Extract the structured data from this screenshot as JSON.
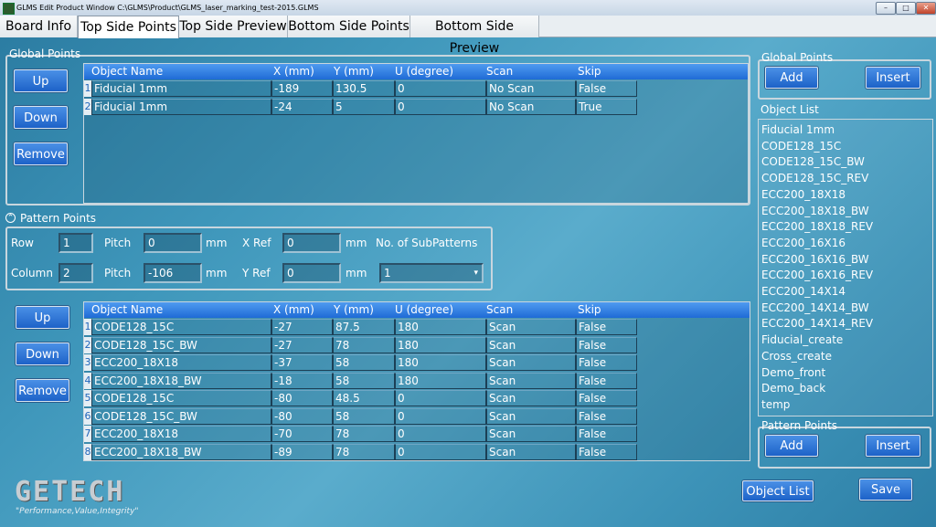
{
  "window": {
    "title": "GLMS Edit Product Window C:\\GLMS\\Product\\GLMS_laser_marking_test-2015.GLMS",
    "min": "–",
    "max": "□",
    "close": "✕"
  },
  "tabs": [
    "Board Info",
    "Top Side Points",
    "Top Side Preview",
    "Bottom Side Points",
    "Bottom Side Preview"
  ],
  "global_points": {
    "label": "Global Points",
    "up": "Up",
    "down": "Down",
    "remove": "Remove",
    "columns": [
      "Object Name",
      "X (mm)",
      "Y (mm)",
      "U (degree)",
      "Scan",
      "Skip"
    ],
    "rows": [
      {
        "n": "1",
        "name": "Fiducial 1mm",
        "x": "-189",
        "y": "130.5",
        "u": "0",
        "scan": "No Scan",
        "skip": "False"
      },
      {
        "n": "2",
        "name": "Fiducial 1mm",
        "x": "-24",
        "y": "5",
        "u": "0",
        "scan": "No Scan",
        "skip": "True"
      }
    ]
  },
  "pattern_points": {
    "label": "Pattern Points",
    "row_label": "Row",
    "row_value": "1",
    "column_label": "Column",
    "column_value": "2",
    "pitch_label": "Pitch",
    "pitch_row": "0",
    "pitch_col": "-106",
    "mm": "mm",
    "xref_label": "X Ref",
    "xref_value": "0",
    "yref_label": "Y Ref",
    "yref_value": "0",
    "subpatterns_label": "No. of SubPatterns",
    "subpatterns_value": "1",
    "up": "Up",
    "down": "Down",
    "remove": "Remove",
    "columns": [
      "Object Name",
      "X (mm)",
      "Y (mm)",
      "U (degree)",
      "Scan",
      "Skip"
    ],
    "rows": [
      {
        "n": "1",
        "name": "CODE128_15C",
        "x": "-27",
        "y": "87.5",
        "u": "180",
        "scan": "Scan",
        "skip": "False"
      },
      {
        "n": "2",
        "name": "CODE128_15C_BW",
        "x": "-27",
        "y": "78",
        "u": "180",
        "scan": "Scan",
        "skip": "False"
      },
      {
        "n": "3",
        "name": "ECC200_18X18",
        "x": "-37",
        "y": "58",
        "u": "180",
        "scan": "Scan",
        "skip": "False"
      },
      {
        "n": "4",
        "name": "ECC200_18X18_BW",
        "x": "-18",
        "y": "58",
        "u": "180",
        "scan": "Scan",
        "skip": "False"
      },
      {
        "n": "5",
        "name": "CODE128_15C",
        "x": "-80",
        "y": "48.5",
        "u": "0",
        "scan": "Scan",
        "skip": "False"
      },
      {
        "n": "6",
        "name": "CODE128_15C_BW",
        "x": "-80",
        "y": "58",
        "u": "0",
        "scan": "Scan",
        "skip": "False"
      },
      {
        "n": "7",
        "name": "ECC200_18X18",
        "x": "-70",
        "y": "78",
        "u": "0",
        "scan": "Scan",
        "skip": "False"
      },
      {
        "n": "8",
        "name": "ECC200_18X18_BW",
        "x": "-89",
        "y": "78",
        "u": "0",
        "scan": "Scan",
        "skip": "False"
      }
    ]
  },
  "right": {
    "global_label": "Global Points",
    "global_add": "Add",
    "global_insert": "Insert",
    "object_list_label": "Object List",
    "objects": [
      "Fiducial 1mm",
      "CODE128_15C",
      "CODE128_15C_BW",
      "CODE128_15C_REV",
      "ECC200_18X18",
      "ECC200_18X18_BW",
      "ECC200_18X18_REV",
      "ECC200_16X16",
      "ECC200_16X16_BW",
      "ECC200_16X16_REV",
      "ECC200_14X14",
      "ECC200_14X14_BW",
      "ECC200_14X14_REV",
      "Fiducial_create",
      "Cross_create",
      "Demo_front",
      "Demo_back",
      "temp"
    ],
    "pattern_label": "Pattern Points",
    "pattern_add": "Add",
    "pattern_insert": "Insert"
  },
  "footer": {
    "object_list_button": "Object List",
    "save_button": "Save",
    "logo": "GETECH",
    "slogan": "\"Performance,Value,Integrity\""
  }
}
